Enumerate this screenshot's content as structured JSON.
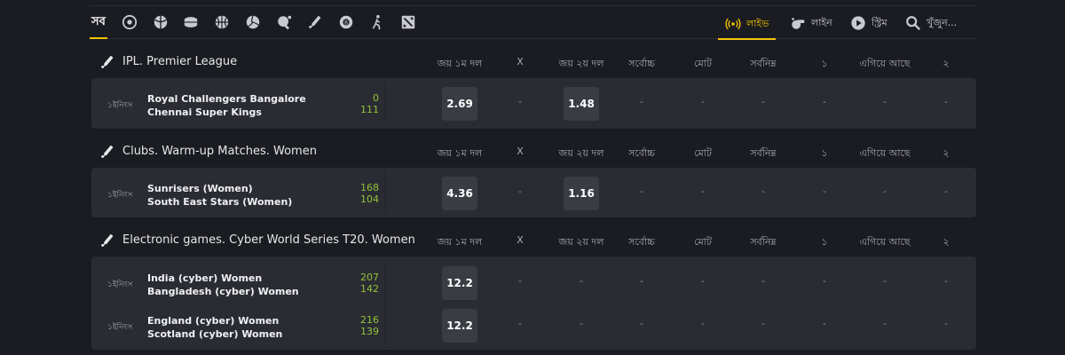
{
  "nav": {
    "all_label": "সব",
    "sports": [
      "football-icon",
      "basketball-icon",
      "hockey-puck-icon",
      "basketball-ball-icon",
      "volleyball-icon",
      "table-tennis-icon",
      "cricket-bat-icon",
      "snooker-ball-icon",
      "esports-runner-icon",
      "dota-icon"
    ],
    "live_label": "লাইভ",
    "line_label": "লাইন",
    "stream_label": "স্ট্রিম",
    "search_label": "খুঁজুন..."
  },
  "columns": [
    "জয় ১ম দল",
    "X",
    "জয় ২য় দল",
    "সর্বোচ্চ",
    "মোট",
    "সর্বনিম্ন",
    "১",
    "এগিয়ে আছে",
    "২"
  ],
  "sections": [
    {
      "title": "IPL. Premier League",
      "matches": [
        {
          "period": "১ইনিংস",
          "team1": "Royal Challengers Bangalore",
          "team2": "Chennai Super Kings",
          "score1": "0",
          "score2": "111",
          "odd1": "2.69",
          "odd2": "1.48"
        }
      ]
    },
    {
      "title": "Clubs. Warm-up Matches. Women",
      "matches": [
        {
          "period": "১ইনিংস",
          "team1": "Sunrisers (Women)",
          "team2": "South East Stars (Women)",
          "score1": "168",
          "score2": "104",
          "odd1": "4.36",
          "odd2": "1.16"
        }
      ]
    },
    {
      "title": "Electronic games. Cyber World Series T20. Women",
      "matches": [
        {
          "period": "১ইনিংস",
          "team1": "India (cyber) Women",
          "team2": "Bangladesh (cyber) Women",
          "score1": "207",
          "score2": "142",
          "odd1": "12.2",
          "odd2": ""
        },
        {
          "period": "১ইনিংস",
          "team1": "England (cyber) Women",
          "team2": "Scotland (cyber) Women",
          "score1": "216",
          "score2": "139",
          "odd1": "12.2",
          "odd2": ""
        }
      ]
    }
  ],
  "dash": "-",
  "accent_color": "#f5c400",
  "score_color": "#8fc43a"
}
